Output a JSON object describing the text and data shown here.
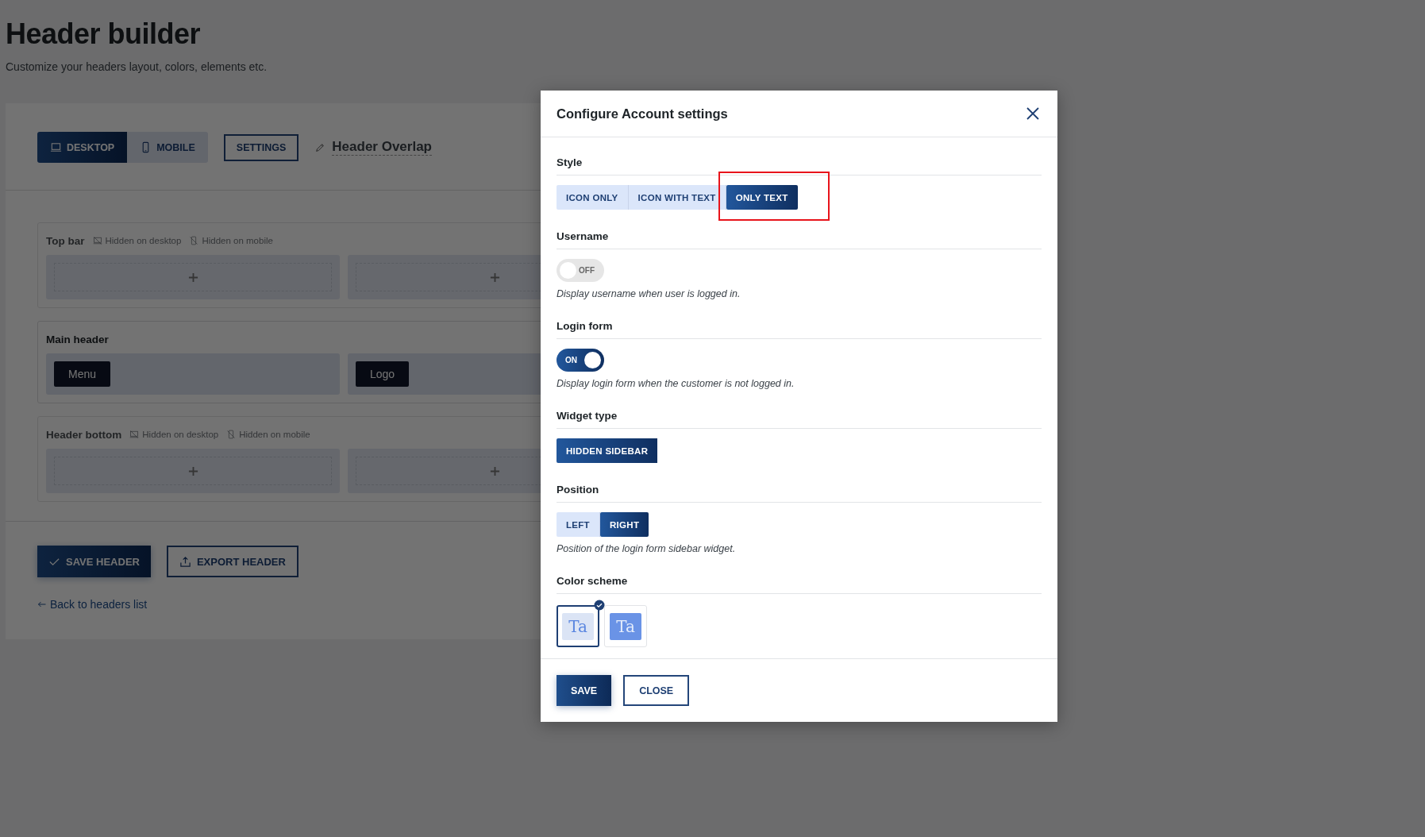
{
  "page": {
    "title": "Header builder",
    "subtitle": "Customize your headers layout, colors, elements etc."
  },
  "builder": {
    "view_tabs": [
      {
        "label": "DESKTOP",
        "selected": true
      },
      {
        "label": "MOBILE",
        "selected": false
      }
    ],
    "settings_button": "SETTINGS",
    "header_name": "Header Overlap",
    "rows": [
      {
        "title": "Top bar",
        "dimmed": true,
        "flags": [
          {
            "label": "Hidden on desktop"
          },
          {
            "label": "Hidden on mobile"
          }
        ],
        "columns": [
          {},
          {}
        ]
      },
      {
        "title": "Main header",
        "dimmed": false,
        "flags": [],
        "columns": [
          {
            "elements": [
              "Menu"
            ]
          },
          {
            "elements": [
              "Logo"
            ]
          }
        ]
      },
      {
        "title": "Header bottom",
        "dimmed": true,
        "flags": [
          {
            "label": "Hidden on desktop"
          },
          {
            "label": "Hidden on mobile"
          }
        ],
        "columns": [
          {},
          {}
        ]
      }
    ],
    "save_button": "SAVE HEADER",
    "export_button": "EXPORT HEADER",
    "back_link": "Back to headers list"
  },
  "modal": {
    "title": "Configure Account settings",
    "sections": [
      {
        "kind": "segmented",
        "label": "Style",
        "options": [
          {
            "label": "ICON ONLY",
            "selected": false,
            "highlighted": false
          },
          {
            "label": "ICON WITH TEXT",
            "selected": false,
            "highlighted": false
          },
          {
            "label": "ONLY TEXT",
            "selected": true,
            "highlighted": true
          }
        ]
      },
      {
        "kind": "toggle",
        "label": "Username",
        "on": false,
        "state_text": "OFF",
        "note": "Display username when user is logged in."
      },
      {
        "kind": "toggle",
        "label": "Login form",
        "on": true,
        "state_text": "ON",
        "note": "Display login form when the customer is not logged in."
      },
      {
        "kind": "segmented",
        "label": "Widget type",
        "options": [
          {
            "label": "HIDDEN SIDEBAR",
            "selected": true,
            "highlighted": false
          }
        ]
      },
      {
        "kind": "segmented",
        "label": "Position",
        "options": [
          {
            "label": "LEFT",
            "selected": false,
            "highlighted": false
          },
          {
            "label": "RIGHT",
            "selected": true,
            "highlighted": false
          }
        ],
        "note": "Position of the login form sidebar widget."
      },
      {
        "kind": "swatches",
        "label": "Color scheme",
        "options": [
          {
            "label": "Ta",
            "selected": true,
            "color": "#dbe4f5"
          },
          {
            "label": "Ta",
            "selected": false,
            "color": "#6a93e6"
          }
        ]
      }
    ],
    "buttons": [
      {
        "label": "SAVE",
        "kind": "primary"
      },
      {
        "label": "CLOSE",
        "kind": "secondary"
      }
    ]
  }
}
